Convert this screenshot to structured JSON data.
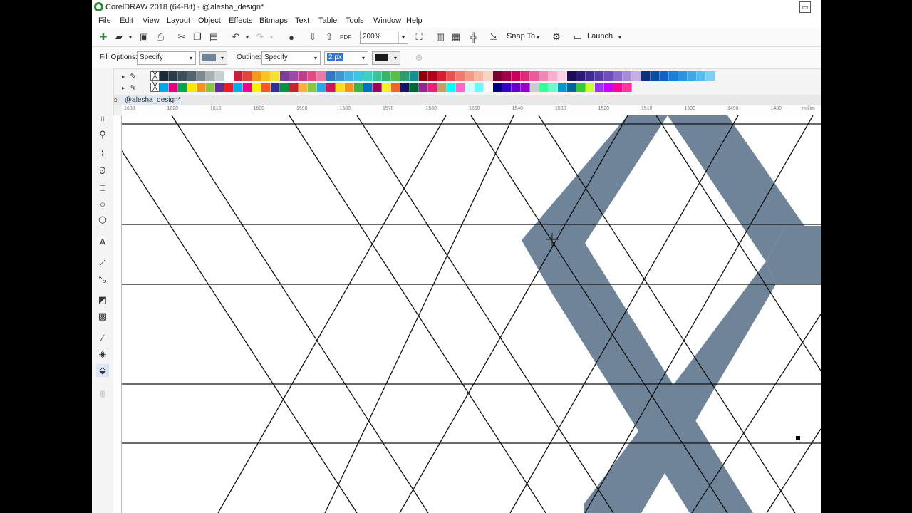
{
  "window": {
    "title": "CorelDRAW 2018 (64-Bit) - @alesha_design*"
  },
  "menu": [
    "File",
    "Edit",
    "View",
    "Layout",
    "Object",
    "Effects",
    "Bitmaps",
    "Text",
    "Table",
    "Tools",
    "Window",
    "Help"
  ],
  "toolbar": {
    "pdf_label": "PDF",
    "zoom": "200%",
    "snap_label": "Snap To",
    "launch_label": "Launch"
  },
  "properties": {
    "fill_label": "Fill Options:",
    "fill_value": "Specify",
    "fill_color": "#708499",
    "outline_label": "Outline:",
    "outline_value": "Specify",
    "outline_width": "2 px",
    "outline_color": "#1a1a1a"
  },
  "palette": {
    "row1": [
      "#1b2a35",
      "#2a3a48",
      "#3c4f5e",
      "#55656f",
      "#7f8a90",
      "#a7b0b4",
      "#c9cfd1",
      "#ffffff",
      "#c41e3a",
      "#e2433a",
      "#f39a1e",
      "#f6c71a",
      "#f4e03a",
      "#7a3f97",
      "#9c4aa6",
      "#c23c8a",
      "#e24a86",
      "#e87aa6",
      "#2f7abf",
      "#3d96d6",
      "#44b1e4",
      "#39c6df",
      "#3ad1c1",
      "#38c49a",
      "#36b56d",
      "#57bf4c",
      "#2e9e6e",
      "#0f8f8f",
      "#8a0010",
      "#b3001b",
      "#d7202f",
      "#ec5151",
      "#f07a6f",
      "#f59a86",
      "#f7b8a2",
      "#fbd3c3",
      "#7a0033",
      "#a3004b",
      "#c9005e",
      "#e0287a",
      "#ea5a9b",
      "#f086b8",
      "#f5add0",
      "#fad0e4",
      "#1b0a5a",
      "#2d1779",
      "#402a92",
      "#5638a6",
      "#6e4fb9",
      "#8b6ac9",
      "#a78ad6",
      "#c4ade4",
      "#0b2f7a",
      "#0d4aa1",
      "#1361c2",
      "#1c7dd8",
      "#2b93e0",
      "#3ea8e8",
      "#55bced",
      "#7dcff2"
    ],
    "row2": [
      "#00a8e8",
      "#e6007e",
      "#00a651",
      "#ffe600",
      "#f7941d",
      "#8dc63f",
      "#662d91",
      "#ed1c24",
      "#00aeef",
      "#ec008c",
      "#fff200",
      "#f15a24",
      "#2e3192",
      "#009245",
      "#c1272d",
      "#fbb03b",
      "#8cc63f",
      "#29abe2",
      "#d4145a",
      "#ffde17",
      "#f7931e",
      "#39b54a",
      "#0071bc",
      "#9e005d",
      "#fcee21",
      "#f26522",
      "#1b1464",
      "#006837",
      "#93278f",
      "#ed1e79",
      "#c69c6d",
      "#00ffff",
      "#ff66cc",
      "#ccffff",
      "#66ffff",
      "#ffffff",
      "#000080",
      "#3300cc",
      "#6600cc",
      "#9900cc",
      "#cccccc",
      "#33ff99",
      "#66ffcc",
      "#0099cc",
      "#006699",
      "#33cc33",
      "#ccff33",
      "#9933ff",
      "#cc00ff",
      "#ff0099",
      "#ff3399"
    ]
  },
  "document": {
    "tab": "@alesha_design*"
  },
  "ruler": {
    "ticks": [
      "1630",
      "1620",
      "1610",
      "1600",
      "1590",
      "1580",
      "1570",
      "1560",
      "1550",
      "1540",
      "1530",
      "1520",
      "1510",
      "1500",
      "1490",
      "1480"
    ],
    "unit": "millim"
  },
  "canvas": {
    "fill_color": "#708499",
    "line_color": "#111111"
  }
}
